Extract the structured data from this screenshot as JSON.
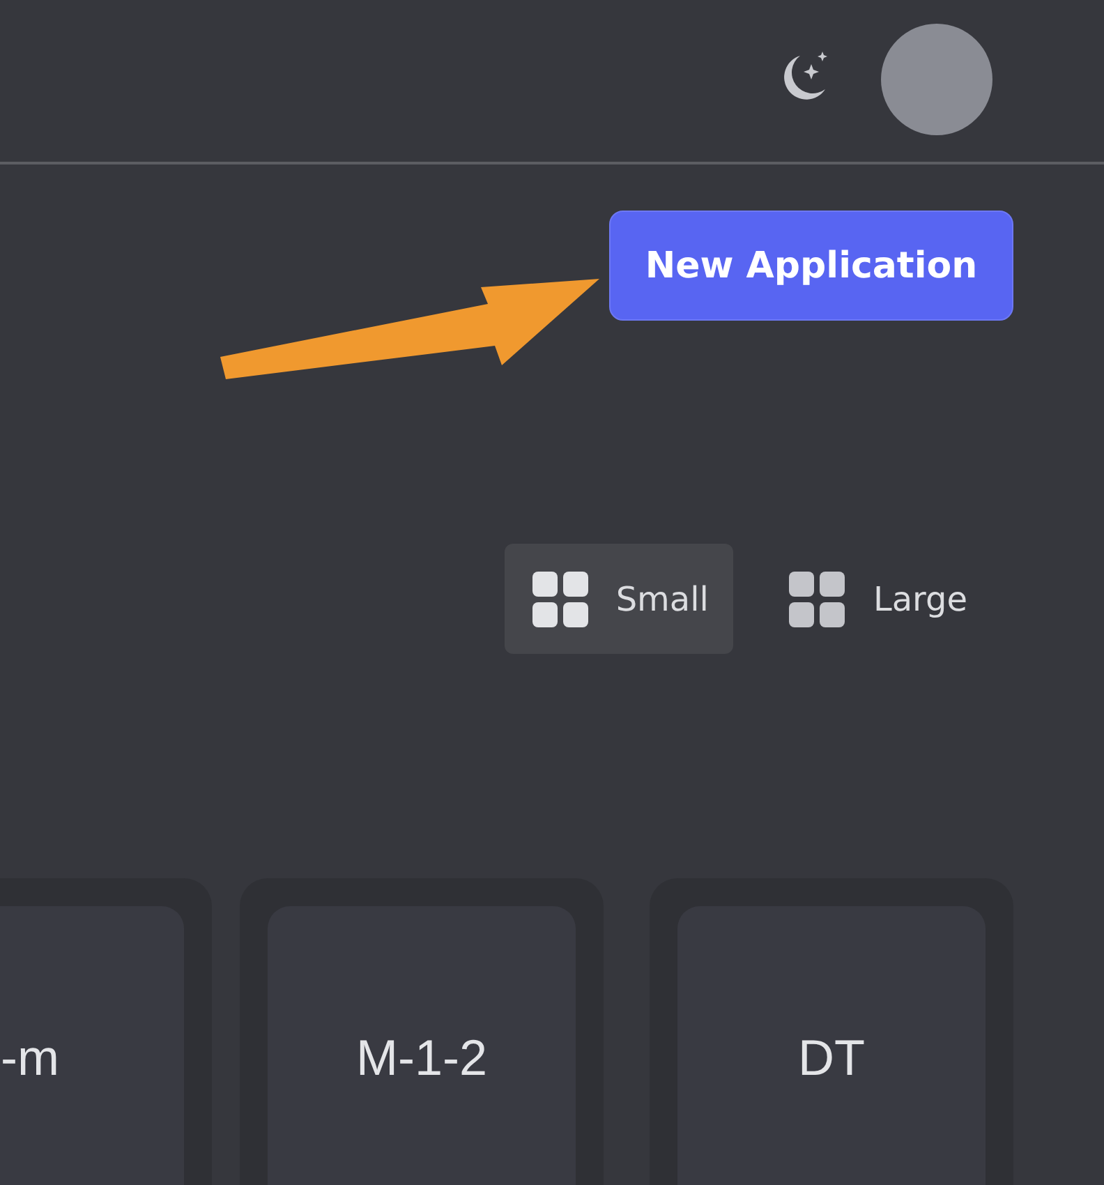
{
  "primary_button": {
    "label": "New Application"
  },
  "view_options": [
    {
      "label": "Small",
      "selected": true
    },
    {
      "label": "Large",
      "selected": false
    }
  ],
  "applications": [
    {
      "name": "-m"
    },
    {
      "name": "M-1-2"
    },
    {
      "name": "DT"
    }
  ]
}
